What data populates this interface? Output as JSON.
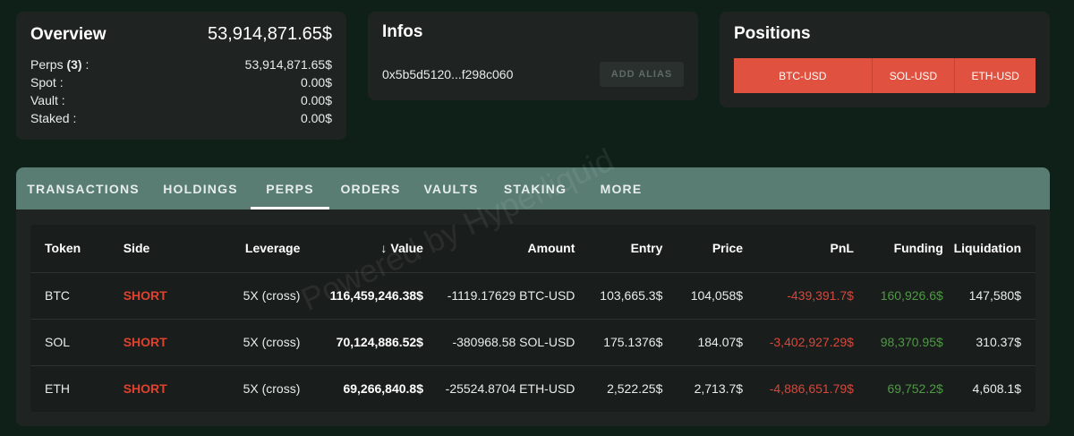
{
  "overview": {
    "title": "Overview",
    "total": "53,914,871.65$",
    "rows": [
      {
        "label": "Perps",
        "count": "(3)",
        "suffix": " :",
        "value": "53,914,871.65$"
      },
      {
        "label": "Spot :",
        "value": "0.00$"
      },
      {
        "label": "Vault :",
        "value": "0.00$"
      },
      {
        "label": "Staked :",
        "value": "0.00$"
      }
    ]
  },
  "infos": {
    "title": "Infos",
    "address": "0x5b5d5120...f298c060",
    "alias_button": "ADD ALIAS"
  },
  "positions": {
    "title": "Positions",
    "segments": [
      {
        "label": "BTC-USD",
        "share": 0.458
      },
      {
        "label": "SOL-USD",
        "share": 0.275
      },
      {
        "label": "ETH-USD",
        "share": 0.267
      }
    ]
  },
  "tabs": [
    "TRANSACTIONS",
    "HOLDINGS",
    "PERPS",
    "ORDERS",
    "VAULTS",
    "STAKING",
    "MORE"
  ],
  "active_tab": "PERPS",
  "table": {
    "headers": [
      "Token",
      "Side",
      "Leverage",
      "Value",
      "Amount",
      "Entry",
      "Price",
      "PnL",
      "Funding",
      "Liquidation"
    ],
    "rows": [
      [
        "BTC",
        "SHORT",
        "5X (cross)",
        "116,459,246.38$",
        "-1119.17629 BTC-USD",
        "103,665.3$",
        "104,058$",
        "-439,391.7$",
        "160,926.6$",
        "147,580$"
      ],
      [
        "SOL",
        "SHORT",
        "5X (cross)",
        "70,124,886.52$",
        "-380968.58 SOL-USD",
        "175.1376$",
        "184.07$",
        "-3,402,927.29$",
        "98,370.95$",
        "310.37$"
      ],
      [
        "ETH",
        "SHORT",
        "5X (cross)",
        "69,266,840.8$",
        "-25524.8704 ETH-USD",
        "2,522.25$",
        "2,713.7$",
        "-4,886,651.79$",
        "69,752.2$",
        "4,608.1$"
      ]
    ]
  },
  "watermark": "Powered by Hyperliquid",
  "colors": {
    "short": "#e0412f",
    "negative": "#d8473b",
    "positive": "#4f9a45",
    "positions_bar": "#e0513f",
    "tab_bar": "#5a7d73"
  }
}
